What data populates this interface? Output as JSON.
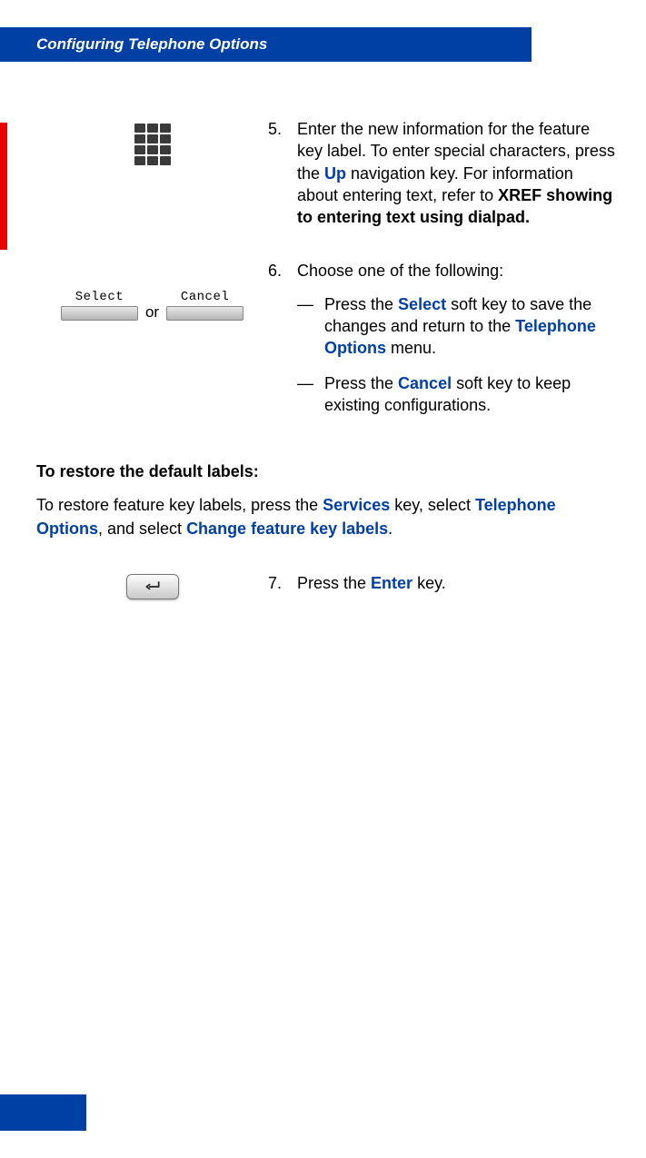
{
  "header": {
    "title": "Configuring Telephone Options"
  },
  "step5": {
    "num": "5.",
    "text_before_up": "Enter the new information for the feature key label. To enter special characters, press the ",
    "up": "Up",
    "text_after_up": " navigation key. For information about entering text, refer to ",
    "xref": "XREF showing to entering text using dialpad."
  },
  "step6": {
    "num": "6.",
    "intro": "Choose one of the following:",
    "softkeys": {
      "select": "Select",
      "cancel": "Cancel",
      "or": "or"
    },
    "opt_a": {
      "dash": "—",
      "t1": "Press the ",
      "select": "Select",
      "t2": " soft key to save the changes and return to the ",
      "menu": "Telephone Options",
      "t3": " menu."
    },
    "opt_b": {
      "dash": "—",
      "t1": "Press the ",
      "cancel": "Cancel",
      "t2": " soft key to keep existing configurations."
    }
  },
  "restore": {
    "title": "To restore the default labels:",
    "t1": "To restore feature key labels, press the ",
    "services": "Services",
    "t2": " key, select ",
    "telopts": "Telephone Options",
    "t3": ", and select ",
    "change": "Change feature key labels",
    "t4": "."
  },
  "step7": {
    "num": "7.",
    "t1": "Press the ",
    "enter": "Enter",
    "t2": " key."
  }
}
